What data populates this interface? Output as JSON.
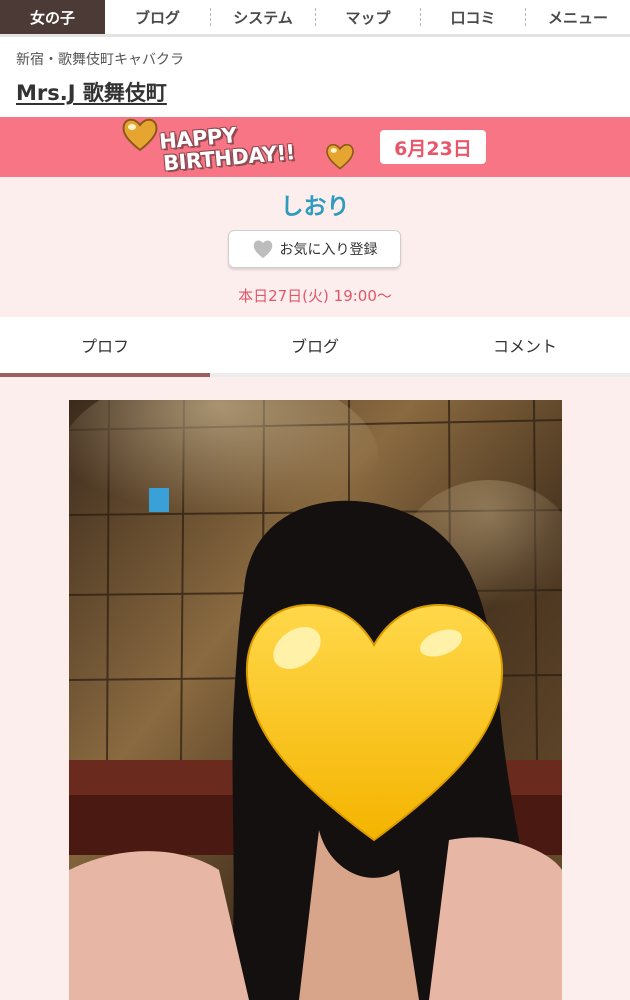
{
  "nav": {
    "tabs": [
      {
        "label": "女の子"
      },
      {
        "label": "ブログ"
      },
      {
        "label": "システム"
      },
      {
        "label": "マップ"
      },
      {
        "label": "口コミ"
      },
      {
        "label": "メニュー"
      }
    ]
  },
  "shop": {
    "category": "新宿・歌舞伎町キャバクラ",
    "name": "Mrs.J 歌舞伎町"
  },
  "birthday": {
    "line1": "HAPPY",
    "line2": "BIRTHDAY!!",
    "date": "6月23日"
  },
  "profile": {
    "name": "しおり",
    "favorite_label": "お気に入り登録",
    "schedule": "本日27日(火) 19:00〜"
  },
  "tabs": [
    {
      "label": "プロフ"
    },
    {
      "label": "ブログ"
    },
    {
      "label": "コメント"
    }
  ],
  "colors": {
    "banner": "#f77584",
    "accent": "#e0566a",
    "name": "#2f9bbd",
    "nav_active": "#4b3a35"
  }
}
